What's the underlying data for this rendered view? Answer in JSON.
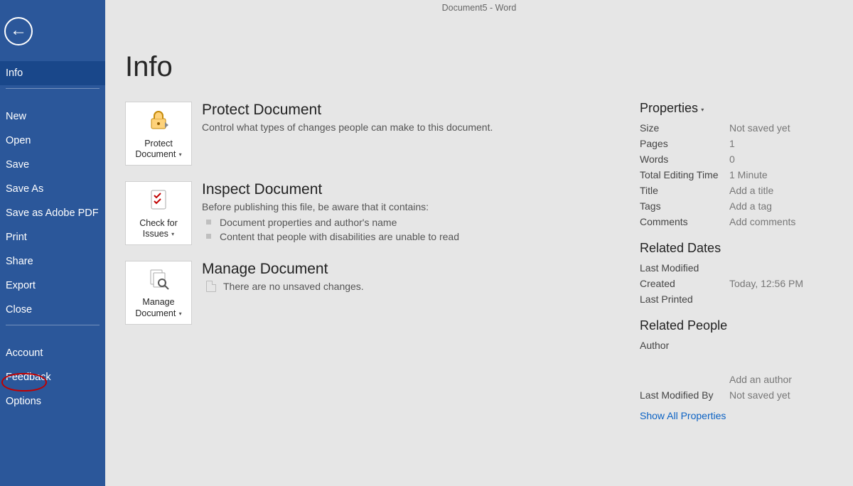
{
  "window_title": "Document5  -  Word",
  "page_heading": "Info",
  "sidebar": {
    "items": [
      {
        "label": "Info",
        "selected": true
      },
      {
        "label": "New"
      },
      {
        "label": "Open"
      },
      {
        "label": "Save"
      },
      {
        "label": "Save As"
      },
      {
        "label": "Save as Adobe PDF"
      },
      {
        "label": "Print"
      },
      {
        "label": "Share"
      },
      {
        "label": "Export"
      },
      {
        "label": "Close"
      }
    ],
    "items2": [
      {
        "label": "Account"
      },
      {
        "label": "Feedback"
      },
      {
        "label": "Options"
      }
    ]
  },
  "cards": {
    "protect": {
      "button_line1": "Protect",
      "button_line2": "Document",
      "title": "Protect Document",
      "desc": "Control what types of changes people can make to this document."
    },
    "inspect": {
      "button_line1": "Check for",
      "button_line2": "Issues",
      "title": "Inspect Document",
      "desc": "Before publishing this file, be aware that it contains:",
      "bullets": [
        "Document properties and author's name",
        "Content that people with disabilities are unable to read"
      ]
    },
    "manage": {
      "button_line1": "Manage",
      "button_line2": "Document",
      "title": "Manage Document",
      "unsaved": "There are no unsaved changes."
    }
  },
  "properties": {
    "heading": "Properties",
    "rows": {
      "size": {
        "label": "Size",
        "value": "Not saved yet"
      },
      "pages": {
        "label": "Pages",
        "value": "1"
      },
      "words": {
        "label": "Words",
        "value": "0"
      },
      "edit_time": {
        "label": "Total Editing Time",
        "value": "1 Minute"
      },
      "title": {
        "label": "Title",
        "value": "Add a title"
      },
      "tags": {
        "label": "Tags",
        "value": "Add a tag"
      },
      "comments": {
        "label": "Comments",
        "value": "Add comments"
      }
    },
    "dates_heading": "Related Dates",
    "dates": {
      "modified": {
        "label": "Last Modified",
        "value": ""
      },
      "created": {
        "label": "Created",
        "value": "Today, 12:56 PM"
      },
      "printed": {
        "label": "Last Printed",
        "value": ""
      }
    },
    "people_heading": "Related People",
    "people": {
      "author": {
        "label": "Author",
        "value": ""
      },
      "add_author": {
        "label": "",
        "value": "Add an author"
      },
      "modified_by": {
        "label": "Last Modified By",
        "value": "Not saved yet"
      }
    },
    "show_all": "Show All Properties"
  }
}
